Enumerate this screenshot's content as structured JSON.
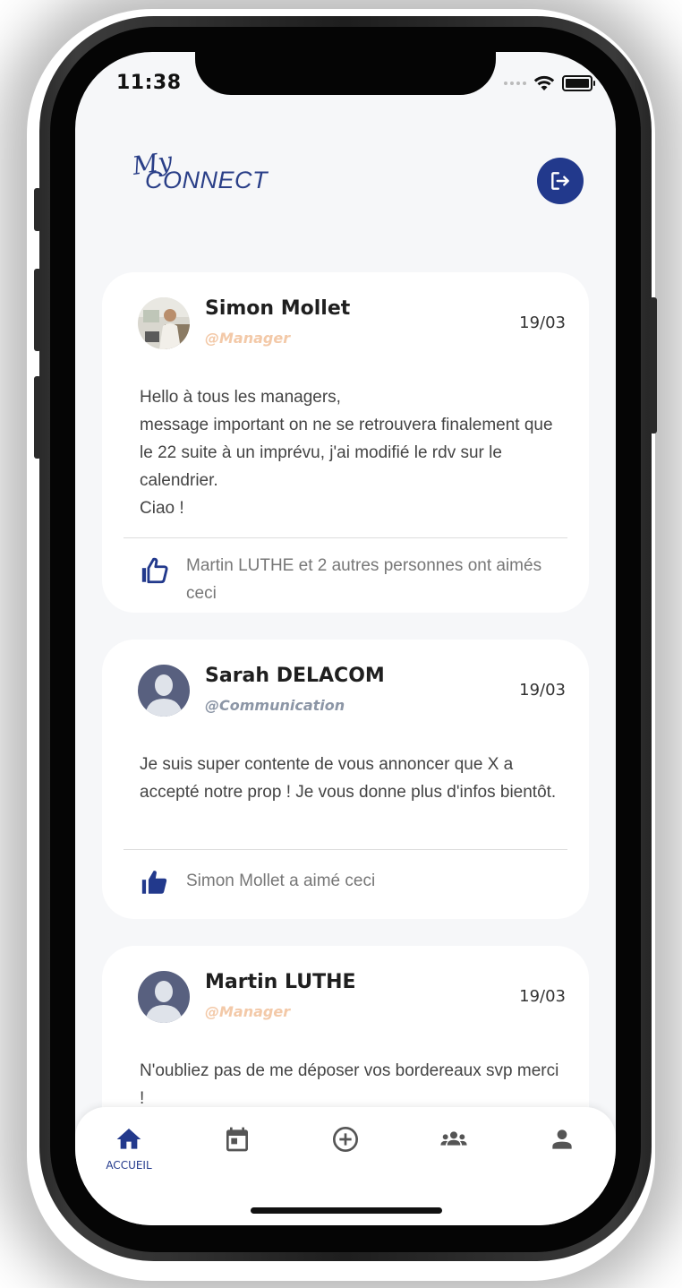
{
  "status_bar": {
    "time": "11:38"
  },
  "header": {
    "logo_my": "My",
    "logo_connect": "CONNECT",
    "logout_icon": "logout-icon"
  },
  "colors": {
    "primary": "#22398c",
    "manager_role": "#f3c9a8",
    "communication_role": "#8c96a6"
  },
  "posts": [
    {
      "author": "Simon Mollet",
      "role": "@Manager",
      "date": "19/03",
      "text": "Hello à tous les managers,\nmessage important on ne se retrouvera finalement que le 22 suite à un imprévu, j'ai modifié le rdv sur le calendrier.\nCiao !",
      "likes": "Martin LUTHE et 2 autres personnes ont aimés ceci",
      "liked": false
    },
    {
      "author": "Sarah DELACOM",
      "role": "@Communication",
      "date": "19/03",
      "text": "Je suis super contente de vous annoncer que X a accepté notre prop ! Je vous donne plus d'infos bientôt.",
      "likes": "Simon Mollet a aimé ceci",
      "liked": true
    },
    {
      "author": "Martin LUTHE",
      "role": "@Manager",
      "date": "19/03",
      "text": "N'oubliez pas de me déposer vos bordereaux svp merci !"
    }
  ],
  "bottom_nav": {
    "items": [
      {
        "icon": "home-icon",
        "label": "ACCUEIL",
        "active": true
      },
      {
        "icon": "calendar-icon",
        "label": ""
      },
      {
        "icon": "add-circle-icon",
        "label": ""
      },
      {
        "icon": "groups-icon",
        "label": ""
      },
      {
        "icon": "person-icon",
        "label": ""
      }
    ]
  }
}
